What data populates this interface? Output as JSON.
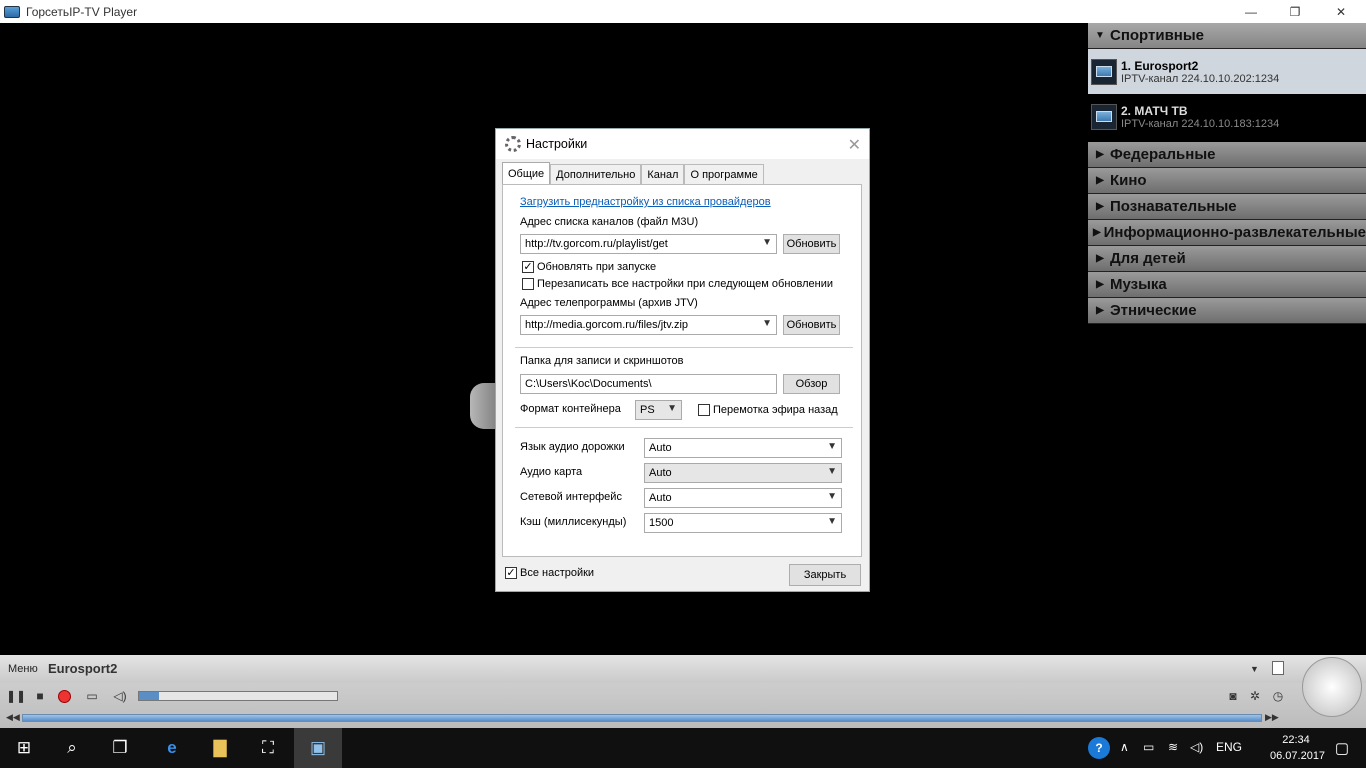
{
  "window": {
    "title": "ГорсетьIP-TV Player"
  },
  "window_controls": {
    "minimize": "—",
    "restore": "❐",
    "close": "✕"
  },
  "channel_panel": {
    "open_category": "Спортивные",
    "channels": [
      {
        "name": "1. Eurosport2",
        "info": "IPTV-канал 224.10.10.202:1234",
        "selected": true
      },
      {
        "name": "2. МАТЧ ТВ",
        "info": "IPTV-канал 224.10.10.183:1234",
        "selected": false
      }
    ],
    "categories": [
      "Федеральные",
      "Кино",
      "Познавательные",
      "Информационно-развлекательные",
      "Для детей",
      "Музыка",
      "Этнические"
    ]
  },
  "dialog": {
    "title": "Настройки",
    "tabs": [
      "Общие",
      "Дополнительно",
      "Канал",
      "О программе"
    ],
    "active_tab": "Общие",
    "load_preset_link": "Загрузить преднастройку из списка провайдеров",
    "playlist_label": "Адрес списка каналов (файл M3U)",
    "playlist_value": "http://tv.gorcom.ru/playlist/get",
    "update_button": "Обновить",
    "update_on_start_label": "Обновлять при запуске",
    "update_on_start_checked": true,
    "overwrite_label": "Перезаписать все настройки при следующем обновлении",
    "overwrite_checked": false,
    "epg_label": "Адрес телепрограммы (архив JTV)",
    "epg_value": "http://media.gorcom.ru/files/jtv.zip",
    "epg_update_button": "Обновить",
    "folder_label": "Папка для записи и скриншотов",
    "folder_value": "C:\\Users\\Koc\\Documents\\",
    "browse_button": "Обзор",
    "container_label": "Формат контейнера",
    "container_value": "PS",
    "timeshift_label": "Перемотка эфира назад",
    "timeshift_checked": false,
    "audio_lang_label": "Язык аудио дорожки",
    "audio_lang_value": "Auto",
    "audio_card_label": "Аудио карта",
    "audio_card_value": "Auto",
    "net_iface_label": "Сетевой интерфейс",
    "net_iface_value": "Auto",
    "cache_label": "Кэш (миллисекунды)",
    "cache_value": "1500",
    "all_settings_label": "Все настройки",
    "all_settings_checked": true,
    "close_button": "Закрыть"
  },
  "player_bar": {
    "menu_label": "Меню",
    "now_playing": "Eurosport2",
    "volume_fraction": 0.1
  },
  "taskbar": {
    "language": "ENG",
    "time": "22:34",
    "date": "06.07.2017"
  }
}
